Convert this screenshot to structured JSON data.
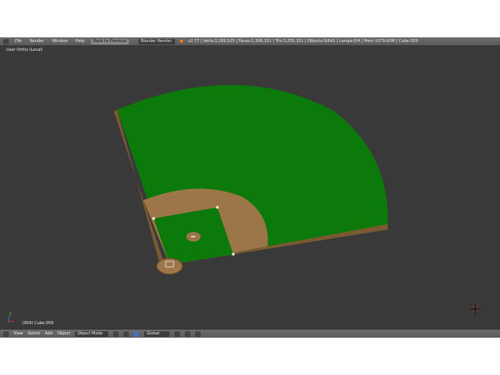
{
  "header": {
    "menus": [
      "File",
      "Render",
      "Window",
      "Help"
    ],
    "back_button": "Back to Previous",
    "render_engine": "Blender Render",
    "stats": "v2.77 | Verts:3,289,525 | Faces:2,396,151 | Tris:3,255,151 | Objects:0/641 | Lamps:0/4 | Mem:1079.60M | Cube.059"
  },
  "viewport": {
    "view_label": "User Ortho (Local)",
    "object_label": "(959) Cube.059"
  },
  "footer": {
    "menus": [
      "View",
      "Select",
      "Add",
      "Object"
    ],
    "mode": "Object Mode",
    "orientation": "Global"
  },
  "colors": {
    "grass": "#0b7a0b",
    "dirt": "#9c7548",
    "background": "#393939"
  }
}
